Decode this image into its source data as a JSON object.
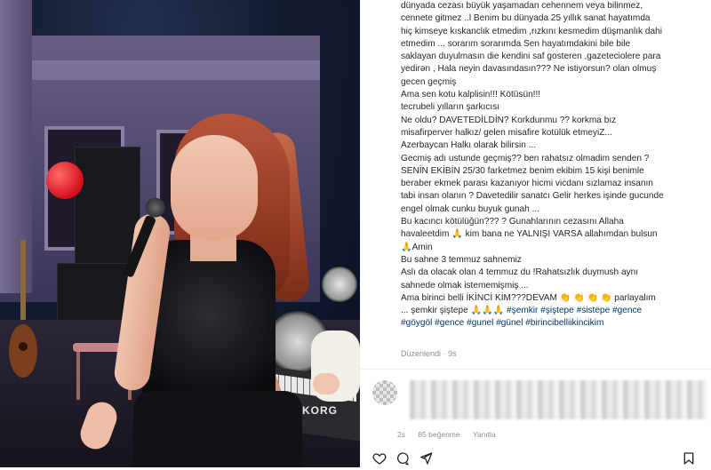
{
  "caption": {
    "lines": [
      "dünyada cezası büyük yaşamadan cehennem veya bilinmez,",
      "cennete gitmez ..l Benim bu dünyada 25 yıllık sanat hayatımda",
      "hiç kimseye kıskanclık etmedim ,rızkını kesmedim düşmanlık dahi",
      "etmedim ... sorarım sorarımda Sen hayatımdakini bile bile",
      "saklayan duyulmasın die kendini saf gosteren ,gazeteciolere para",
      "yedirən , Hala neyin davasındasın??? Ne istiyorsun? olan olmuş",
      "gecen geçmiş",
      "Ama sen kotu kalplisin!!! Kötüsün!!!",
      "tecrubeli yılların şarkıcısı",
      "Ne oldu? DAVETEDİLDİN? Korkdunmu ?? korkma bız",
      "misafirperver halkız/ gelen misafire kotülük etmeyiZ...",
      "Azerbaycan Halkı olarak bilirsin ...",
      "Gecmiş adı ustunde geçmiş?? ben rahatsız olmadim senden ?",
      "SENİN EKİBİN 25/30 farketmez benim ekibim 15 kişi benimle",
      "beraber ekmek parası kazanıyor hicmi vicdanı sızlamaz insanın",
      "tabi insan olanın ? Davetedilir sanatcı Gelir herkes işinde gucunde",
      "engel olmak cunku buyuk gunah ...",
      "Bu kacıncı kötülüğün??? ? Gunahlarının cezasını Allaha",
      "havaleetdim 🙏 kim bana ne YALNIŞI VARSA allahımdan bulsun",
      "🙏Amin",
      "Bu sahne 3 temmuz sahnemiz",
      "Aslı da olacak olan 4 temmuz du !Rahatsızlık duymush aynı",
      "sahnede olmak istememişmiş ...",
      "Ama birinci belli İKİNCİ KİM???DEVAM 👏 👏 👏 👏 parlayalım",
      "... şemkir şiştepe 🙏🙏🙏 "
    ],
    "hashtag_line1_prefix": "... şemkir şiştepe 🙏🙏🙏 ",
    "hashtags1": "#şemkir #şiştepe #sistepe #gence",
    "hashtags2": "#göygöl #gence #gunel #günel #birincibelliikincikim",
    "edited_time": "Düzenlendi · 9s"
  },
  "comment": {
    "meta_time": "2s",
    "meta_likes": "85 beğenme",
    "meta_reply": "Yanıtla"
  },
  "icons": {
    "like": "heart-icon",
    "comment": "comment-icon",
    "share": "share-icon",
    "save": "bookmark-icon"
  },
  "photo": {
    "keyboard_brand": "KORG"
  }
}
